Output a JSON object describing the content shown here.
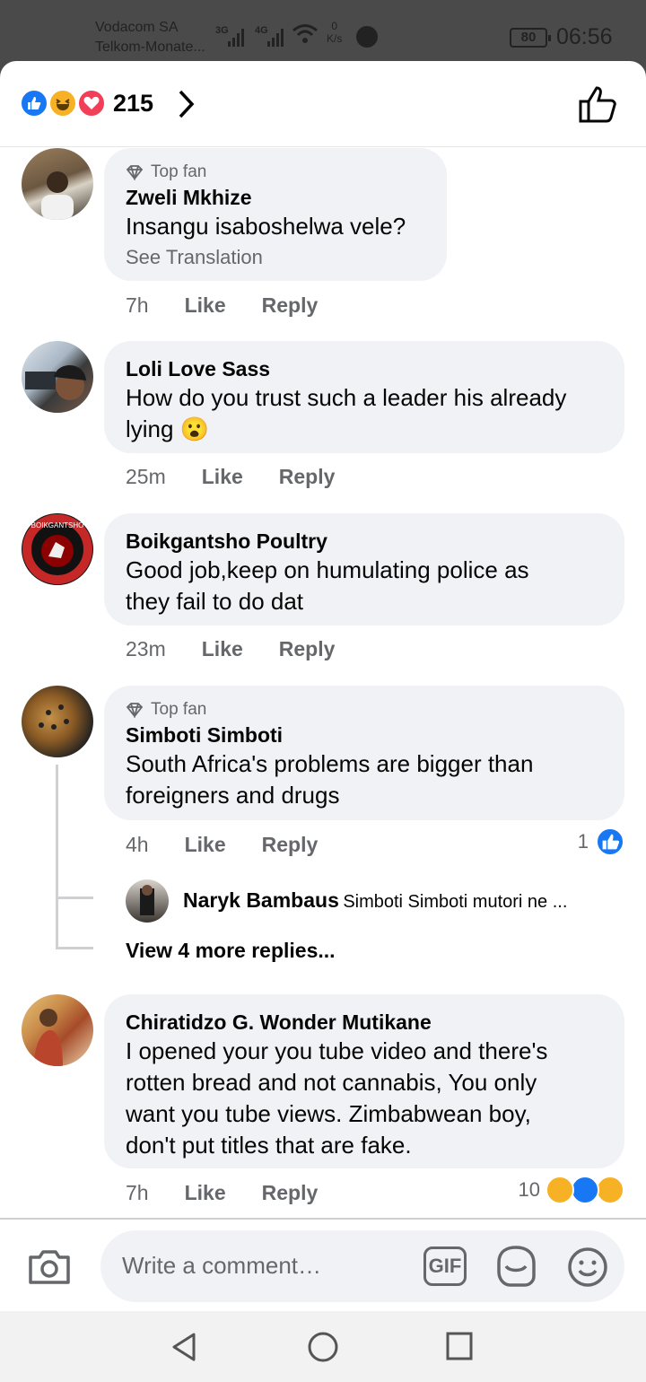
{
  "status_bar": {
    "carrier_1": "Vodacom SA",
    "carrier_2": "Telkom-Monate...",
    "net_1": "3G",
    "net_2": "4G",
    "speed_value": "0",
    "speed_unit": "K/s",
    "battery": "80",
    "time": "06:56"
  },
  "reactions_bar": {
    "count": "215",
    "icons": [
      "like-reaction-icon",
      "haha-reaction-icon",
      "love-reaction-icon"
    ]
  },
  "comments": [
    {
      "top_fan": "Top fan",
      "author": "Zweli Mkhize",
      "text": "Insangu isaboshelwa vele?",
      "translate": "See Translation",
      "time": "7h",
      "like": "Like",
      "reply": "Reply"
    },
    {
      "author": "Loli Love Sass",
      "text_line1": "How do you trust such a leader his already",
      "text_line2": "lying",
      "emoji": "😮",
      "time": "25m",
      "like": "Like",
      "reply": "Reply"
    },
    {
      "author": "Boikgantsho Poultry",
      "text_line1": "Good job,keep on humulating police as",
      "text_line2": "they fail to do dat",
      "time": "23m",
      "like": "Like",
      "reply": "Reply",
      "avatar_text": "BOIKGANTSHO"
    },
    {
      "top_fan": "Top fan",
      "author": "Simboti Simboti",
      "text_line1": "South Africa's problems are bigger than",
      "text_line2": "foreigners and drugs",
      "time": "4h",
      "like": "Like",
      "reply": "Reply",
      "reaction_count": "1",
      "reply_preview": {
        "author": "Naryk Bambaus",
        "text": "Simboti Simboti  mutori ne ..."
      },
      "view_more": "View 4 more replies..."
    },
    {
      "author": "Chiratidzo G. Wonder Mutikane",
      "text_line1": "I opened your you tube video and there's",
      "text_line2": "rotten bread and not cannabis, You only",
      "text_line3": "want you tube views. Zimbabwean boy,",
      "text_line4": "don't put titles that are fake.",
      "time": "7h",
      "like": "Like",
      "reply": "Reply",
      "reaction_count": "10"
    }
  ],
  "composer": {
    "placeholder": "Write a comment…",
    "gif_label": "GIF"
  },
  "colors": {
    "brand_blue": "#1877f2",
    "haha_yellow": "#f7b125",
    "love_red": "#f33e58",
    "bubble_bg": "#f0f2f5",
    "secondary_text": "#65676b"
  }
}
